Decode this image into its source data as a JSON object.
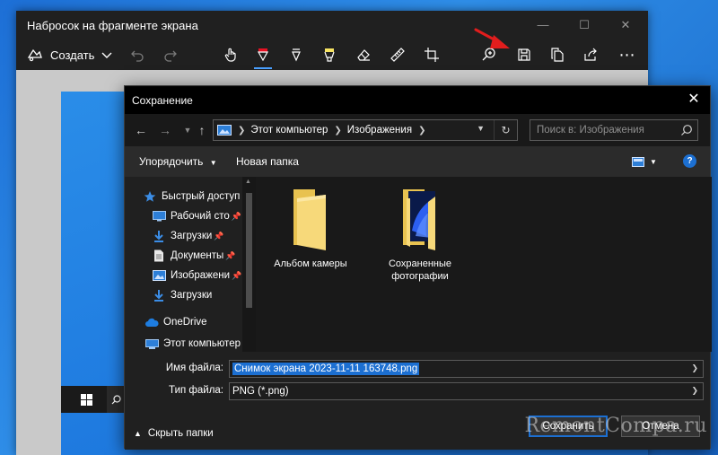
{
  "snip_window": {
    "title": "Набросок на фрагменте экрана",
    "create_label": "Создать",
    "tools": [
      "touch-writing-icon",
      "ballpoint-pen-icon",
      "pencil-icon",
      "highlighter-icon",
      "eraser-icon",
      "ruler-icon",
      "crop-icon",
      "zoom-icon",
      "save-icon",
      "copy-icon",
      "share-icon",
      "more-icon"
    ]
  },
  "dialog": {
    "title": "Сохранение",
    "breadcrumb": [
      "Этот компьютер",
      "Изображения"
    ],
    "search_placeholder": "Поиск в: Изображения",
    "organize_label": "Упорядочить",
    "new_folder_label": "Новая папка",
    "help_label": "?",
    "nav_items": [
      {
        "label": "Быстрый доступ",
        "icon": "star-icon"
      },
      {
        "label": "Рабочий сто",
        "icon": "desktop-icon",
        "pinned": true
      },
      {
        "label": "Загрузки",
        "icon": "download-icon",
        "pinned": true
      },
      {
        "label": "Документы",
        "icon": "document-icon",
        "pinned": true
      },
      {
        "label": "Изображени",
        "icon": "pictures-icon",
        "pinned": true
      },
      {
        "label": "Загрузки",
        "icon": "download-icon"
      },
      {
        "label": "OneDrive",
        "icon": "cloud-icon"
      },
      {
        "label": "Этот компьютер",
        "icon": "computer-icon"
      }
    ],
    "files": [
      {
        "label": "Альбом камеры"
      },
      {
        "label": "Сохраненные фотографии"
      }
    ],
    "filename_label": "Имя файла:",
    "filename_value": "Снимок экрана 2023-11-11 163748.png",
    "filetype_label": "Тип файла:",
    "filetype_value": "PNG (*.png)",
    "hide_folders_label": "Скрыть папки",
    "save_label": "Сохранить",
    "cancel_label": "Отмена"
  },
  "watermark": "RemontCompa.ru",
  "colors": {
    "accent": "#1c6fd1",
    "arrow": "#e11d1d",
    "highlighter": "#f7e463",
    "pen": "#e81123"
  }
}
